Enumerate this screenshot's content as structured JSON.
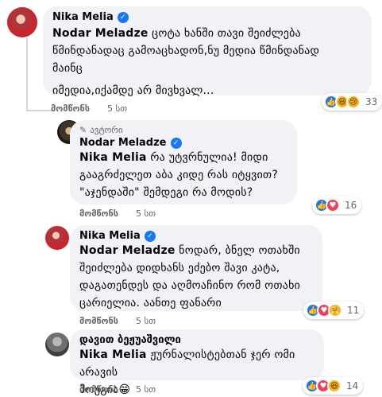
{
  "comments": [
    {
      "author": "Nika Melia",
      "mention": "Nodar Meladze",
      "text_line1": " ცოტა ხანში თავი შეიძლება",
      "text_line2": "წმინდანადაც გამოაცხადონ,ნუ მედია წმინდანად",
      "text_line3": "მაინც",
      "text_line4": "იმედია,იქამდე არ მივხვალ...",
      "like_label": "მომწონს",
      "time": "5 სთ",
      "reaction_count": "33",
      "reactions": [
        "like-icon",
        "haha-icon",
        "sad-icon"
      ]
    },
    {
      "badge": "ავტორი",
      "author": "Nodar Meladze",
      "mention": "Nika Melia",
      "text_line1": " რა უტვრნულია! მიდი",
      "text_line2": "გააგრძელეთ აბა კიდე რას იტყვით?",
      "text_line3": "\"აჯენდაში\" შემდეგი რა მოდის?",
      "like_label": "მომწონს",
      "time": "5 სთ",
      "reaction_count": "16",
      "reactions": [
        "like-icon",
        "love-icon"
      ]
    },
    {
      "author": "Nika Melia",
      "mention": "Nodar Meladze",
      "text_line1": " ნოდარ, ბნელ ოთახში",
      "text_line2": "შეიძლება დიდხანს ეძებო შავი კატა,",
      "text_line3": "დაგათენდეს და აღმოაჩინო რომ ოთახი",
      "text_line4": "ცარიელია. აანთე ფანარი",
      "like_label": "მომწონს",
      "time": "5 სთ",
      "reaction_count": "11",
      "reactions": [
        "like-icon",
        "love-icon",
        "care-icon"
      ]
    },
    {
      "author": "დავით ბეჟუაშვილი",
      "mention": "Nika Melia",
      "text_line1": " ჟურნალისტებთან ჯერ ომი არავის",
      "text_line2": "მოუგია😁",
      "like_label": "მომწონს",
      "time": "5 სთ",
      "reaction_count": "14",
      "reactions": [
        "like-icon",
        "love-icon",
        "haha-icon"
      ]
    }
  ]
}
